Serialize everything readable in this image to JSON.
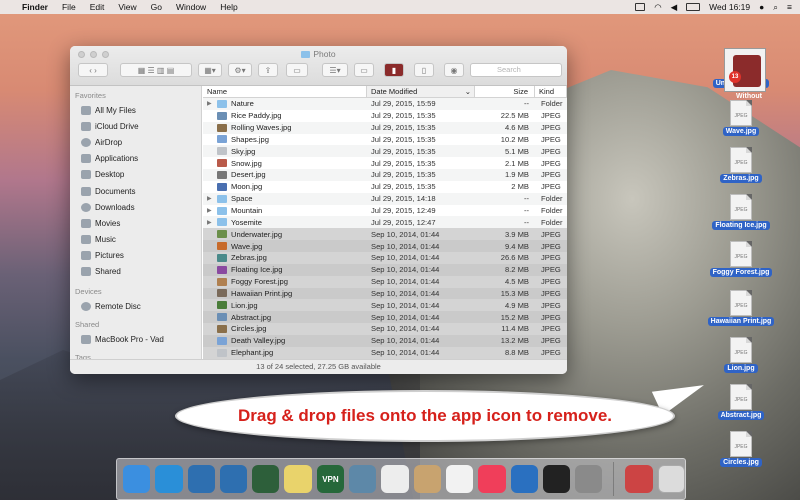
{
  "menubar": {
    "apple": "",
    "items": [
      "Finder",
      "File",
      "Edit",
      "View",
      "Go",
      "Window",
      "Help"
    ],
    "clock": "Wed 16:19"
  },
  "window": {
    "title": "Photo",
    "search_placeholder": "Search",
    "status": "13 of 24 selected, 27.25 GB available"
  },
  "sidebar": {
    "favorites_label": "Favorites",
    "favorites": [
      "All My Files",
      "iCloud Drive",
      "AirDrop",
      "Applications",
      "Desktop",
      "Documents",
      "Downloads",
      "Movies",
      "Music",
      "Pictures",
      "Shared"
    ],
    "devices_label": "Devices",
    "devices": [
      "Remote Disc"
    ],
    "shared_label": "Shared",
    "shared": [
      "MacBook Pro - Vad"
    ],
    "tags_label": "Tags"
  },
  "columns": {
    "name": "Name",
    "date": "Date Modified",
    "size": "Size",
    "kind": "Kind"
  },
  "files": [
    {
      "name": "Nature",
      "date": "Jul 29, 2015, 15:59",
      "size": "--",
      "kind": "Folder",
      "folder": true,
      "sel": false
    },
    {
      "name": "Rice Paddy.jpg",
      "date": "Jul 29, 2015, 15:35",
      "size": "22.5 MB",
      "kind": "JPEG",
      "folder": false,
      "sel": false
    },
    {
      "name": "Rolling Waves.jpg",
      "date": "Jul 29, 2015, 15:35",
      "size": "4.6 MB",
      "kind": "JPEG",
      "folder": false,
      "sel": false
    },
    {
      "name": "Shapes.jpg",
      "date": "Jul 29, 2015, 15:35",
      "size": "10.2 MB",
      "kind": "JPEG",
      "folder": false,
      "sel": false
    },
    {
      "name": "Sky.jpg",
      "date": "Jul 29, 2015, 15:35",
      "size": "5.1 MB",
      "kind": "JPEG",
      "folder": false,
      "sel": false
    },
    {
      "name": "Snow.jpg",
      "date": "Jul 29, 2015, 15:35",
      "size": "2.1 MB",
      "kind": "JPEG",
      "folder": false,
      "sel": false
    },
    {
      "name": "Desert.jpg",
      "date": "Jul 29, 2015, 15:35",
      "size": "1.9 MB",
      "kind": "JPEG",
      "folder": false,
      "sel": false
    },
    {
      "name": "Moon.jpg",
      "date": "Jul 29, 2015, 15:35",
      "size": "2 MB",
      "kind": "JPEG",
      "folder": false,
      "sel": false
    },
    {
      "name": "Space",
      "date": "Jul 29, 2015, 14:18",
      "size": "--",
      "kind": "Folder",
      "folder": true,
      "sel": false
    },
    {
      "name": "Mountain",
      "date": "Jul 29, 2015, 12:49",
      "size": "--",
      "kind": "Folder",
      "folder": true,
      "sel": false
    },
    {
      "name": "Yosemite",
      "date": "Jul 29, 2015, 12:47",
      "size": "--",
      "kind": "Folder",
      "folder": true,
      "sel": false
    },
    {
      "name": "Underwater.jpg",
      "date": "Sep 10, 2014, 01:44",
      "size": "3.9 MB",
      "kind": "JPEG",
      "folder": false,
      "sel": true
    },
    {
      "name": "Wave.jpg",
      "date": "Sep 10, 2014, 01:44",
      "size": "9.4 MB",
      "kind": "JPEG",
      "folder": false,
      "sel": true
    },
    {
      "name": "Zebras.jpg",
      "date": "Sep 10, 2014, 01:44",
      "size": "26.6 MB",
      "kind": "JPEG",
      "folder": false,
      "sel": true
    },
    {
      "name": "Floating Ice.jpg",
      "date": "Sep 10, 2014, 01:44",
      "size": "8.2 MB",
      "kind": "JPEG",
      "folder": false,
      "sel": true
    },
    {
      "name": "Foggy Forest.jpg",
      "date": "Sep 10, 2014, 01:44",
      "size": "4.5 MB",
      "kind": "JPEG",
      "folder": false,
      "sel": true
    },
    {
      "name": "Hawaiian Print.jpg",
      "date": "Sep 10, 2014, 01:44",
      "size": "15.3 MB",
      "kind": "JPEG",
      "folder": false,
      "sel": true
    },
    {
      "name": "Lion.jpg",
      "date": "Sep 10, 2014, 01:44",
      "size": "4.9 MB",
      "kind": "JPEG",
      "folder": false,
      "sel": true
    },
    {
      "name": "Abstract.jpg",
      "date": "Sep 10, 2014, 01:44",
      "size": "15.2 MB",
      "kind": "JPEG",
      "folder": false,
      "sel": true
    },
    {
      "name": "Circles.jpg",
      "date": "Sep 10, 2014, 01:44",
      "size": "11.4 MB",
      "kind": "JPEG",
      "folder": false,
      "sel": true
    },
    {
      "name": "Death Valley.jpg",
      "date": "Sep 10, 2014, 01:44",
      "size": "13.2 MB",
      "kind": "JPEG",
      "folder": false,
      "sel": true
    },
    {
      "name": "Elephant.jpg",
      "date": "Sep 10, 2014, 01:44",
      "size": "8.8 MB",
      "kind": "JPEG",
      "folder": false,
      "sel": true
    }
  ],
  "callout": {
    "text": "Drag & drop files onto the app icon to remove."
  },
  "desktop_files": [
    {
      "label": "Underwater.jpg"
    },
    {
      "label": "Wave.jpg"
    },
    {
      "label": "Zebras.jpg"
    },
    {
      "label": "Floating Ice.jpg"
    },
    {
      "label": "Foggy Forest.jpg"
    },
    {
      "label": "Hawaiian Print.jpg"
    },
    {
      "label": "Lion.jpg"
    },
    {
      "label": "Abstract.jpg"
    },
    {
      "label": "Circles.jpg"
    }
  ],
  "drag_badge": {
    "count": "13",
    "label": "Without"
  },
  "doc_icon_text": "JPEG",
  "dock": [
    {
      "name": "finder",
      "color": "#3b8fe0"
    },
    {
      "name": "safari",
      "color": "#2a8fd8"
    },
    {
      "name": "sync-1",
      "color": "#2e6fb0"
    },
    {
      "name": "sync-2",
      "color": "#2e6fb0"
    },
    {
      "name": "sync-3",
      "color": "#2d5f3a"
    },
    {
      "name": "notes",
      "color": "#e9d36b"
    },
    {
      "name": "vpn",
      "color": "#26683a",
      "text": "VPN"
    },
    {
      "name": "preview",
      "color": "#5d88a8"
    },
    {
      "name": "textedit",
      "color": "#ededed"
    },
    {
      "name": "contacts",
      "color": "#c8a36f"
    },
    {
      "name": "photos",
      "color": "#f2f2f2"
    },
    {
      "name": "music",
      "color": "#f03e5a"
    },
    {
      "name": "quicktime",
      "color": "#2a70c0"
    },
    {
      "name": "terminal",
      "color": "#222222"
    },
    {
      "name": "system-prefs",
      "color": "#8a8a8a"
    },
    {
      "name": "trash-app",
      "color": "#c44"
    }
  ]
}
